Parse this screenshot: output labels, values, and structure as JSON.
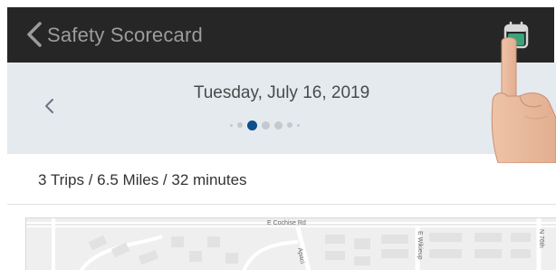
{
  "navbar": {
    "title": "Safety Scorecard",
    "back_icon": "chevron-left-icon",
    "calendar_icon": "calendar-icon",
    "bg_color": "#262626"
  },
  "date_header": {
    "date": "Tuesday, July 16, 2019",
    "prev_icon": "chevron-left-icon",
    "page_count": 7,
    "active_page": 2,
    "active_dot_color": "#0c4f8c"
  },
  "summary": {
    "text": "3 Trips / 6.5 Miles / 32 minutes"
  },
  "map": {
    "streets": [
      {
        "name": "E Cochise Rd"
      },
      {
        "name": "Apaci"
      },
      {
        "name": "E Wikieup"
      },
      {
        "name": "N 76th"
      }
    ]
  }
}
